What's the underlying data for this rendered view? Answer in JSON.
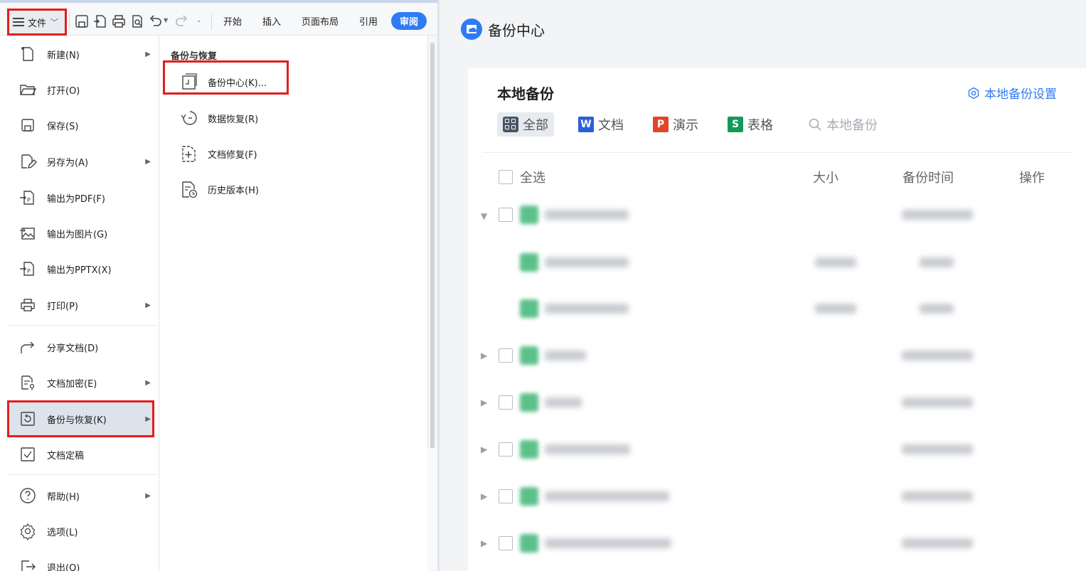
{
  "toolbar": {
    "file_label": "文件",
    "tabs": [
      "开始",
      "插入",
      "页面布局",
      "引用"
    ],
    "active_tab": "审阅"
  },
  "file_menu": {
    "items": [
      {
        "label": "新建(N)",
        "icon": "new-doc-icon",
        "submenu": true
      },
      {
        "label": "打开(O)",
        "icon": "folder-open-icon",
        "submenu": false
      },
      {
        "label": "保存(S)",
        "icon": "save-icon",
        "submenu": false
      },
      {
        "label": "另存为(A)",
        "icon": "save-as-icon",
        "submenu": true
      },
      {
        "label": "输出为PDF(F)",
        "icon": "export-pdf-icon",
        "submenu": false
      },
      {
        "label": "输出为图片(G)",
        "icon": "export-image-icon",
        "submenu": false
      },
      {
        "label": "输出为PPTX(X)",
        "icon": "export-pptx-icon",
        "submenu": false
      },
      {
        "label": "打印(P)",
        "icon": "printer-icon",
        "submenu": true
      },
      {
        "label": "分享文档(D)",
        "icon": "share-icon",
        "submenu": false
      },
      {
        "label": "文档加密(E)",
        "icon": "encrypt-icon",
        "submenu": true
      },
      {
        "label": "备份与恢复(K)",
        "icon": "backup-restore-icon",
        "submenu": true,
        "selected": true
      },
      {
        "label": "文档定稿",
        "icon": "finalize-icon",
        "submenu": false
      },
      {
        "label": "帮助(H)",
        "icon": "help-icon",
        "submenu": true
      },
      {
        "label": "选项(L)",
        "icon": "settings-icon",
        "submenu": false
      },
      {
        "label": "退出(Q)",
        "icon": "exit-icon",
        "submenu": false
      }
    ]
  },
  "submenu": {
    "title": "备份与恢复",
    "items": [
      {
        "label": "备份中心(K)...",
        "icon": "backup-center-icon",
        "highlighted": true
      },
      {
        "label": "数据恢复(R)",
        "icon": "data-recovery-icon"
      },
      {
        "label": "文档修复(F)",
        "icon": "doc-repair-icon"
      },
      {
        "label": "历史版本(H)",
        "icon": "history-version-icon"
      }
    ]
  },
  "backup_center": {
    "title": "备份中心",
    "panel_title": "本地备份",
    "settings_label": "本地备份设置",
    "filters": [
      {
        "label": "全部",
        "active": true
      },
      {
        "label": "文档",
        "badge": "W",
        "color": "#2b5fd9"
      },
      {
        "label": "演示",
        "badge": "P",
        "color": "#e0452a"
      },
      {
        "label": "表格",
        "badge": "S",
        "color": "#14995a"
      }
    ],
    "search_placeholder": "本地备份",
    "columns": {
      "select_all": "全选",
      "size": "大小",
      "time": "备份时间",
      "actions": "操作"
    }
  }
}
